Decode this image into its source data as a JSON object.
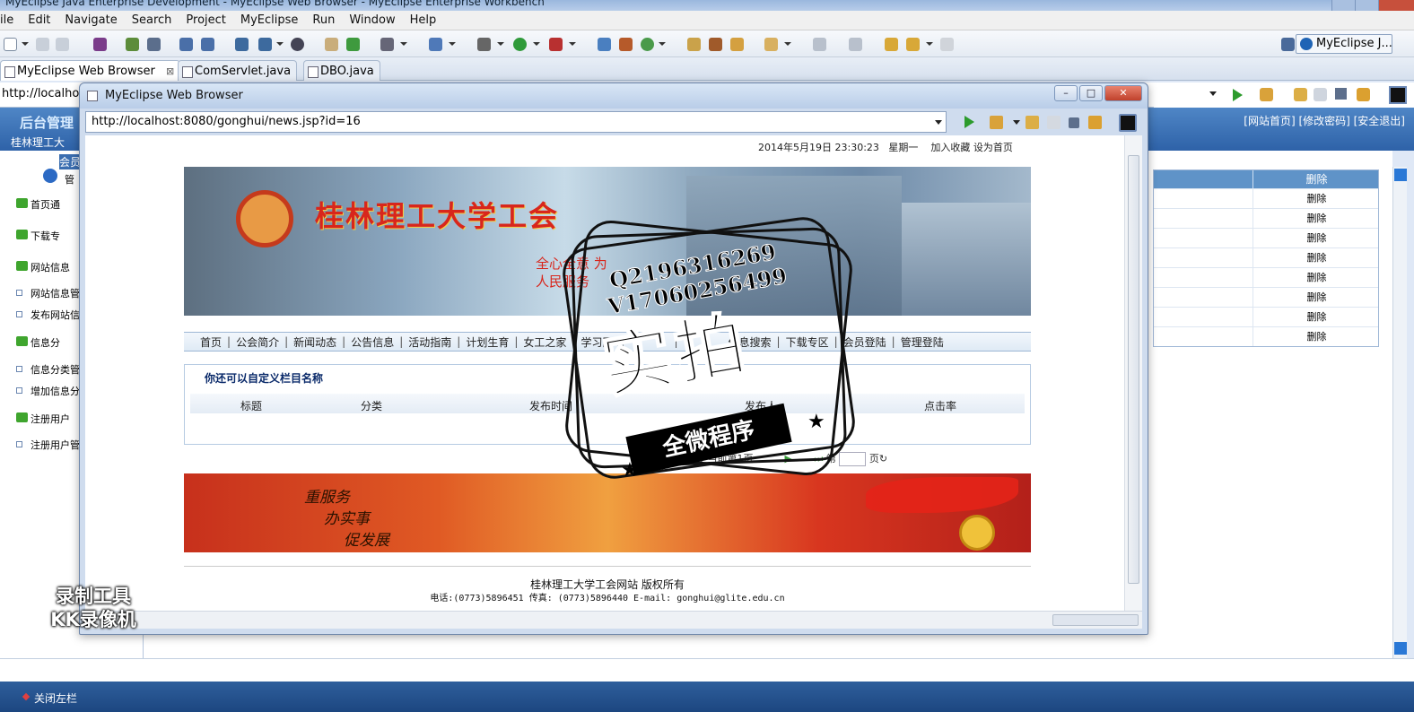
{
  "window_title": "MyEclipse Java Enterprise Development - MyEclipse Web Browser - MyEclipse Enterprise Workbench",
  "menu": [
    "ile",
    "Edit",
    "Navigate",
    "Search",
    "Project",
    "MyEclipse",
    "Run",
    "Window",
    "Help"
  ],
  "perspective_label": "MyEclipse J...",
  "editor_tabs": [
    {
      "label": "MyEclipse Web Browser",
      "close": "⊠"
    },
    {
      "label": "ComServlet.java"
    },
    {
      "label": "DBO.java"
    }
  ],
  "background": {
    "address_fragment": "http://localhos",
    "admin_title": "后台管理",
    "university_fragment": "桂林理工大",
    "member_fragment": "会员",
    "admin_user_fragment": "管",
    "top_links": "[网站首页] [修改密码] [安全退出]",
    "nav_groups": [
      "首页通",
      "下载专",
      "网站信息",
      "信息分",
      "注册用户"
    ],
    "nav_items": [
      "网站信息管",
      "发布网站信",
      "信息分类管",
      "增加信息分",
      "注册用户管"
    ],
    "table_header": "删除",
    "table_rows": [
      "删除",
      "删除",
      "删除",
      "删除",
      "删除",
      "删除",
      "删除",
      "删除"
    ],
    "bottom_text": "关闭左栏"
  },
  "popup": {
    "title": "MyEclipse Web Browser",
    "controls": {
      "minimize": "–",
      "maximize": "□",
      "close": "✕"
    },
    "url": "http://localhost:8080/gonghui/news.jsp?id=16"
  },
  "site": {
    "date": "2014年5月19日",
    "time": "23:30:23",
    "weekday": "星期一",
    "bookmark": "加入收藏",
    "homepage": "设为首页",
    "banner_name": "桂林理工大学工会",
    "banner_slogan": "全心全意 为人民服务",
    "nav": [
      "首页",
      "公会简介",
      "新闻动态",
      "公告信息",
      "活动指南",
      "计划生育",
      "女工之家",
      "学习园地",
      "",
      "",
      "",
      "信息搜索",
      "下载专区",
      "会员登陆",
      "管理登陆"
    ],
    "box_title": "你还可以自定义栏目名称",
    "columns": [
      "标题",
      "分类",
      "发布时间",
      "发布人",
      "点击率"
    ],
    "pager": {
      "total": "共计0页",
      "current": "当前第1页",
      "page_prefix": "第",
      "page_suffix": "页"
    },
    "ad_lines": [
      "重服务",
      "办实事",
      "促发展"
    ],
    "footer_name": "桂林理工大学工会网站 版权所有",
    "footer_contact": "电话:(0773)5896451 传真: (0773)5896440 E-mail: gonghui@glite.edu.cn"
  },
  "stamp": {
    "qq": "Q2196316269",
    "vx": "V17060256499",
    "big": "实拍",
    "banner": "全微程序"
  },
  "recorder": [
    "录制工具",
    "KK录像机"
  ]
}
